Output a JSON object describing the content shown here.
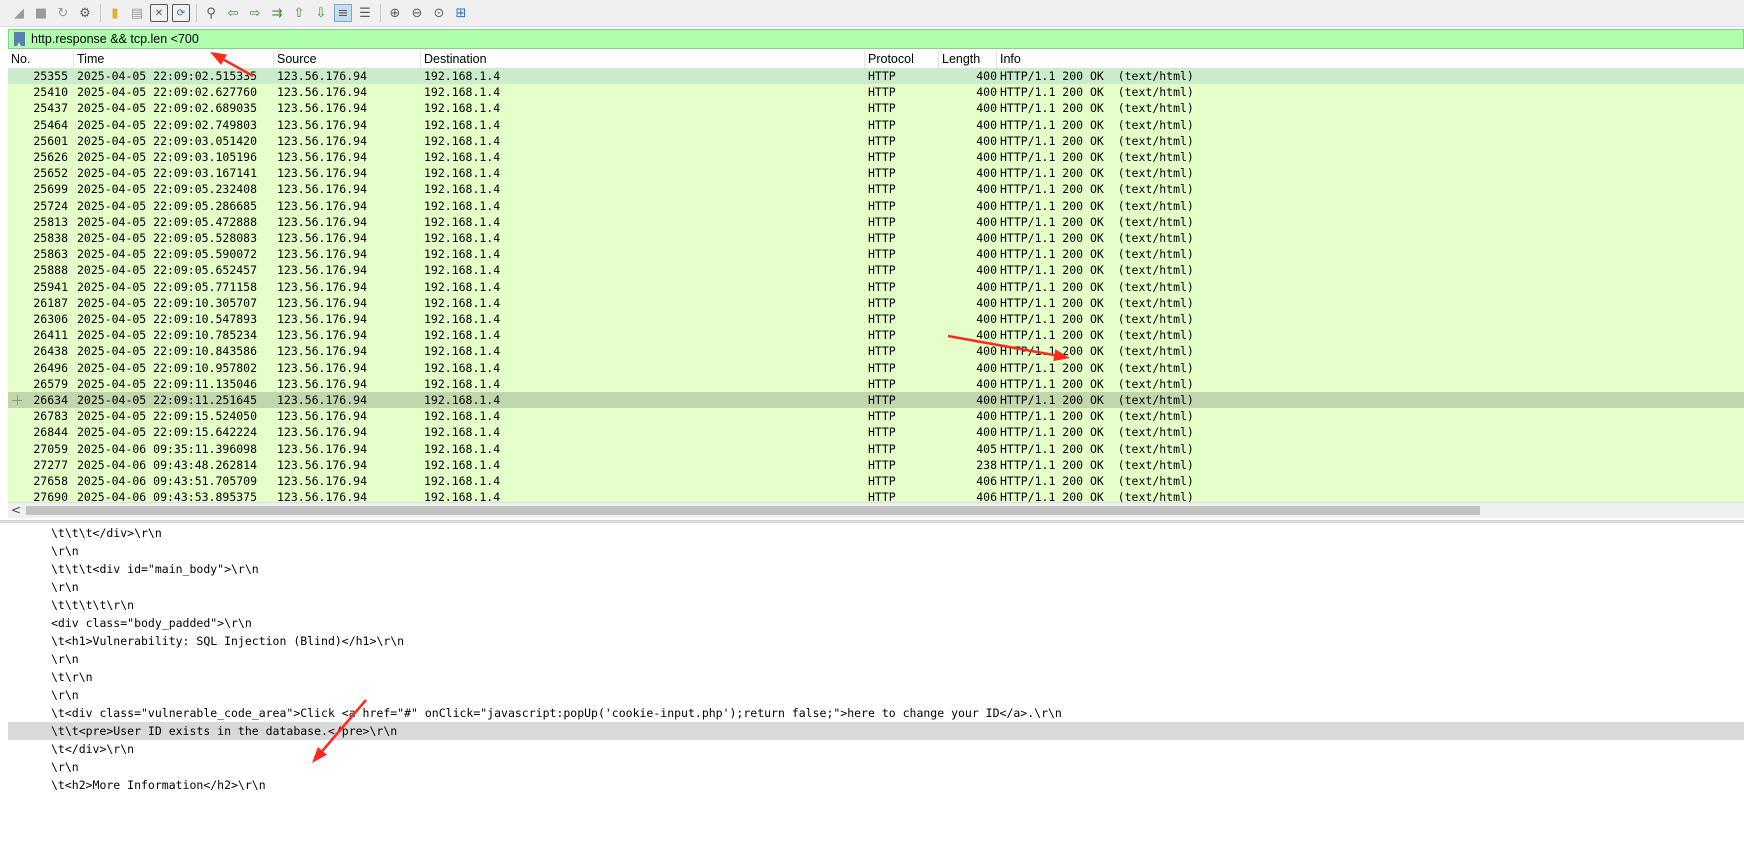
{
  "toolbar": {
    "icons": [
      "shark-fin-start-icon",
      "stop-capture-icon",
      "restart-capture-icon",
      "capture-options-icon",
      "open-file-icon",
      "save-file-icon",
      "close-file-icon",
      "reload-file-icon",
      "find-packet-icon",
      "go-back-icon",
      "go-forward-icon",
      "go-to-packet-icon",
      "first-packet-icon",
      "last-packet-icon",
      "autoscroll-icon",
      "colorize-icon",
      "zoom-in-icon",
      "zoom-out-icon",
      "normal-size-icon",
      "resize-columns-icon"
    ]
  },
  "filter": {
    "value": "http.response && tcp.len <700"
  },
  "packet_list": {
    "columns": [
      "No.",
      "Time",
      "Source",
      "Destination",
      "Protocol",
      "Length",
      "Info"
    ],
    "rows": [
      {
        "no": "25355",
        "time": "2025-04-05 22:09:02.515335",
        "src": "123.56.176.94",
        "dst": "192.168.1.4",
        "proto": "HTTP",
        "len": "400",
        "info": "HTTP/1.1 200 OK  (text/html)"
      },
      {
        "no": "25410",
        "time": "2025-04-05 22:09:02.627760",
        "src": "123.56.176.94",
        "dst": "192.168.1.4",
        "proto": "HTTP",
        "len": "400",
        "info": "HTTP/1.1 200 OK  (text/html)"
      },
      {
        "no": "25437",
        "time": "2025-04-05 22:09:02.689035",
        "src": "123.56.176.94",
        "dst": "192.168.1.4",
        "proto": "HTTP",
        "len": "400",
        "info": "HTTP/1.1 200 OK  (text/html)"
      },
      {
        "no": "25464",
        "time": "2025-04-05 22:09:02.749803",
        "src": "123.56.176.94",
        "dst": "192.168.1.4",
        "proto": "HTTP",
        "len": "400",
        "info": "HTTP/1.1 200 OK  (text/html)"
      },
      {
        "no": "25601",
        "time": "2025-04-05 22:09:03.051420",
        "src": "123.56.176.94",
        "dst": "192.168.1.4",
        "proto": "HTTP",
        "len": "400",
        "info": "HTTP/1.1 200 OK  (text/html)"
      },
      {
        "no": "25626",
        "time": "2025-04-05 22:09:03.105196",
        "src": "123.56.176.94",
        "dst": "192.168.1.4",
        "proto": "HTTP",
        "len": "400",
        "info": "HTTP/1.1 200 OK  (text/html)"
      },
      {
        "no": "25652",
        "time": "2025-04-05 22:09:03.167141",
        "src": "123.56.176.94",
        "dst": "192.168.1.4",
        "proto": "HTTP",
        "len": "400",
        "info": "HTTP/1.1 200 OK  (text/html)"
      },
      {
        "no": "25699",
        "time": "2025-04-05 22:09:05.232408",
        "src": "123.56.176.94",
        "dst": "192.168.1.4",
        "proto": "HTTP",
        "len": "400",
        "info": "HTTP/1.1 200 OK  (text/html)"
      },
      {
        "no": "25724",
        "time": "2025-04-05 22:09:05.286685",
        "src": "123.56.176.94",
        "dst": "192.168.1.4",
        "proto": "HTTP",
        "len": "400",
        "info": "HTTP/1.1 200 OK  (text/html)"
      },
      {
        "no": "25813",
        "time": "2025-04-05 22:09:05.472888",
        "src": "123.56.176.94",
        "dst": "192.168.1.4",
        "proto": "HTTP",
        "len": "400",
        "info": "HTTP/1.1 200 OK  (text/html)"
      },
      {
        "no": "25838",
        "time": "2025-04-05 22:09:05.528083",
        "src": "123.56.176.94",
        "dst": "192.168.1.4",
        "proto": "HTTP",
        "len": "400",
        "info": "HTTP/1.1 200 OK  (text/html)"
      },
      {
        "no": "25863",
        "time": "2025-04-05 22:09:05.590072",
        "src": "123.56.176.94",
        "dst": "192.168.1.4",
        "proto": "HTTP",
        "len": "400",
        "info": "HTTP/1.1 200 OK  (text/html)"
      },
      {
        "no": "25888",
        "time": "2025-04-05 22:09:05.652457",
        "src": "123.56.176.94",
        "dst": "192.168.1.4",
        "proto": "HTTP",
        "len": "400",
        "info": "HTTP/1.1 200 OK  (text/html)"
      },
      {
        "no": "25941",
        "time": "2025-04-05 22:09:05.771158",
        "src": "123.56.176.94",
        "dst": "192.168.1.4",
        "proto": "HTTP",
        "len": "400",
        "info": "HTTP/1.1 200 OK  (text/html)"
      },
      {
        "no": "26187",
        "time": "2025-04-05 22:09:10.305707",
        "src": "123.56.176.94",
        "dst": "192.168.1.4",
        "proto": "HTTP",
        "len": "400",
        "info": "HTTP/1.1 200 OK  (text/html)"
      },
      {
        "no": "26306",
        "time": "2025-04-05 22:09:10.547893",
        "src": "123.56.176.94",
        "dst": "192.168.1.4",
        "proto": "HTTP",
        "len": "400",
        "info": "HTTP/1.1 200 OK  (text/html)"
      },
      {
        "no": "26411",
        "time": "2025-04-05 22:09:10.785234",
        "src": "123.56.176.94",
        "dst": "192.168.1.4",
        "proto": "HTTP",
        "len": "400",
        "info": "HTTP/1.1 200 OK  (text/html)"
      },
      {
        "no": "26438",
        "time": "2025-04-05 22:09:10.843586",
        "src": "123.56.176.94",
        "dst": "192.168.1.4",
        "proto": "HTTP",
        "len": "400",
        "info": "HTTP/1.1 200 OK  (text/html)"
      },
      {
        "no": "26496",
        "time": "2025-04-05 22:09:10.957802",
        "src": "123.56.176.94",
        "dst": "192.168.1.4",
        "proto": "HTTP",
        "len": "400",
        "info": "HTTP/1.1 200 OK  (text/html)"
      },
      {
        "no": "26579",
        "time": "2025-04-05 22:09:11.135046",
        "src": "123.56.176.94",
        "dst": "192.168.1.4",
        "proto": "HTTP",
        "len": "400",
        "info": "HTTP/1.1 200 OK  (text/html)"
      },
      {
        "no": "26634",
        "time": "2025-04-05 22:09:11.251645",
        "src": "123.56.176.94",
        "dst": "192.168.1.4",
        "proto": "HTTP",
        "len": "400",
        "info": "HTTP/1.1 200 OK  (text/html)"
      },
      {
        "no": "26783",
        "time": "2025-04-05 22:09:15.524050",
        "src": "123.56.176.94",
        "dst": "192.168.1.4",
        "proto": "HTTP",
        "len": "400",
        "info": "HTTP/1.1 200 OK  (text/html)"
      },
      {
        "no": "26844",
        "time": "2025-04-05 22:09:15.642224",
        "src": "123.56.176.94",
        "dst": "192.168.1.4",
        "proto": "HTTP",
        "len": "400",
        "info": "HTTP/1.1 200 OK  (text/html)"
      },
      {
        "no": "27059",
        "time": "2025-04-06 09:35:11.396098",
        "src": "123.56.176.94",
        "dst": "192.168.1.4",
        "proto": "HTTP",
        "len": "405",
        "info": "HTTP/1.1 200 OK  (text/html)"
      },
      {
        "no": "27277",
        "time": "2025-04-06 09:43:48.262814",
        "src": "123.56.176.94",
        "dst": "192.168.1.4",
        "proto": "HTTP",
        "len": "238",
        "info": "HTTP/1.1 200 OK  (text/html)"
      },
      {
        "no": "27658",
        "time": "2025-04-06 09:43:51.705709",
        "src": "123.56.176.94",
        "dst": "192.168.1.4",
        "proto": "HTTP",
        "len": "406",
        "info": "HTTP/1.1 200 OK  (text/html)"
      },
      {
        "no": "27690",
        "time": "2025-04-06 09:43:53.895375",
        "src": "123.56.176.94",
        "dst": "192.168.1.4",
        "proto": "HTTP",
        "len": "406",
        "info": "HTTP/1.1 200 OK  (text/html)"
      }
    ],
    "colors": {
      "row_bg": "#e4ffc7",
      "first_row_bg": "#cbeccb",
      "marked_row_bg": "#c2d6ad"
    }
  },
  "scrollbar": {
    "left_arrow": "<"
  },
  "detail_lines": [
    "\\t\\t\\t</div>\\r\\n",
    "\\r\\n",
    "\\t\\t\\t<div id=\"main_body\">\\r\\n",
    "\\r\\n",
    "\\t\\t\\t\\t\\r\\n",
    "<div class=\"body_padded\">\\r\\n",
    "\\t<h1>Vulnerability: SQL Injection (Blind)</h1>\\r\\n",
    "\\r\\n",
    "\\t\\r\\n",
    "\\r\\n",
    "\\t<div class=\"vulnerable_code_area\">Click <a href=\"#\" onClick=\"javascript:popUp('cookie-input.php');return false;\">here to change your ID</a>.\\r\\n",
    "\\t\\t<pre>User ID exists in the database.</pre>\\r\\n",
    "\\t</div>\\r\\n",
    "\\r\\n",
    "\\t<h2>More Information</h2>\\r\\n"
  ],
  "annotation_color": "#ff2a1f"
}
